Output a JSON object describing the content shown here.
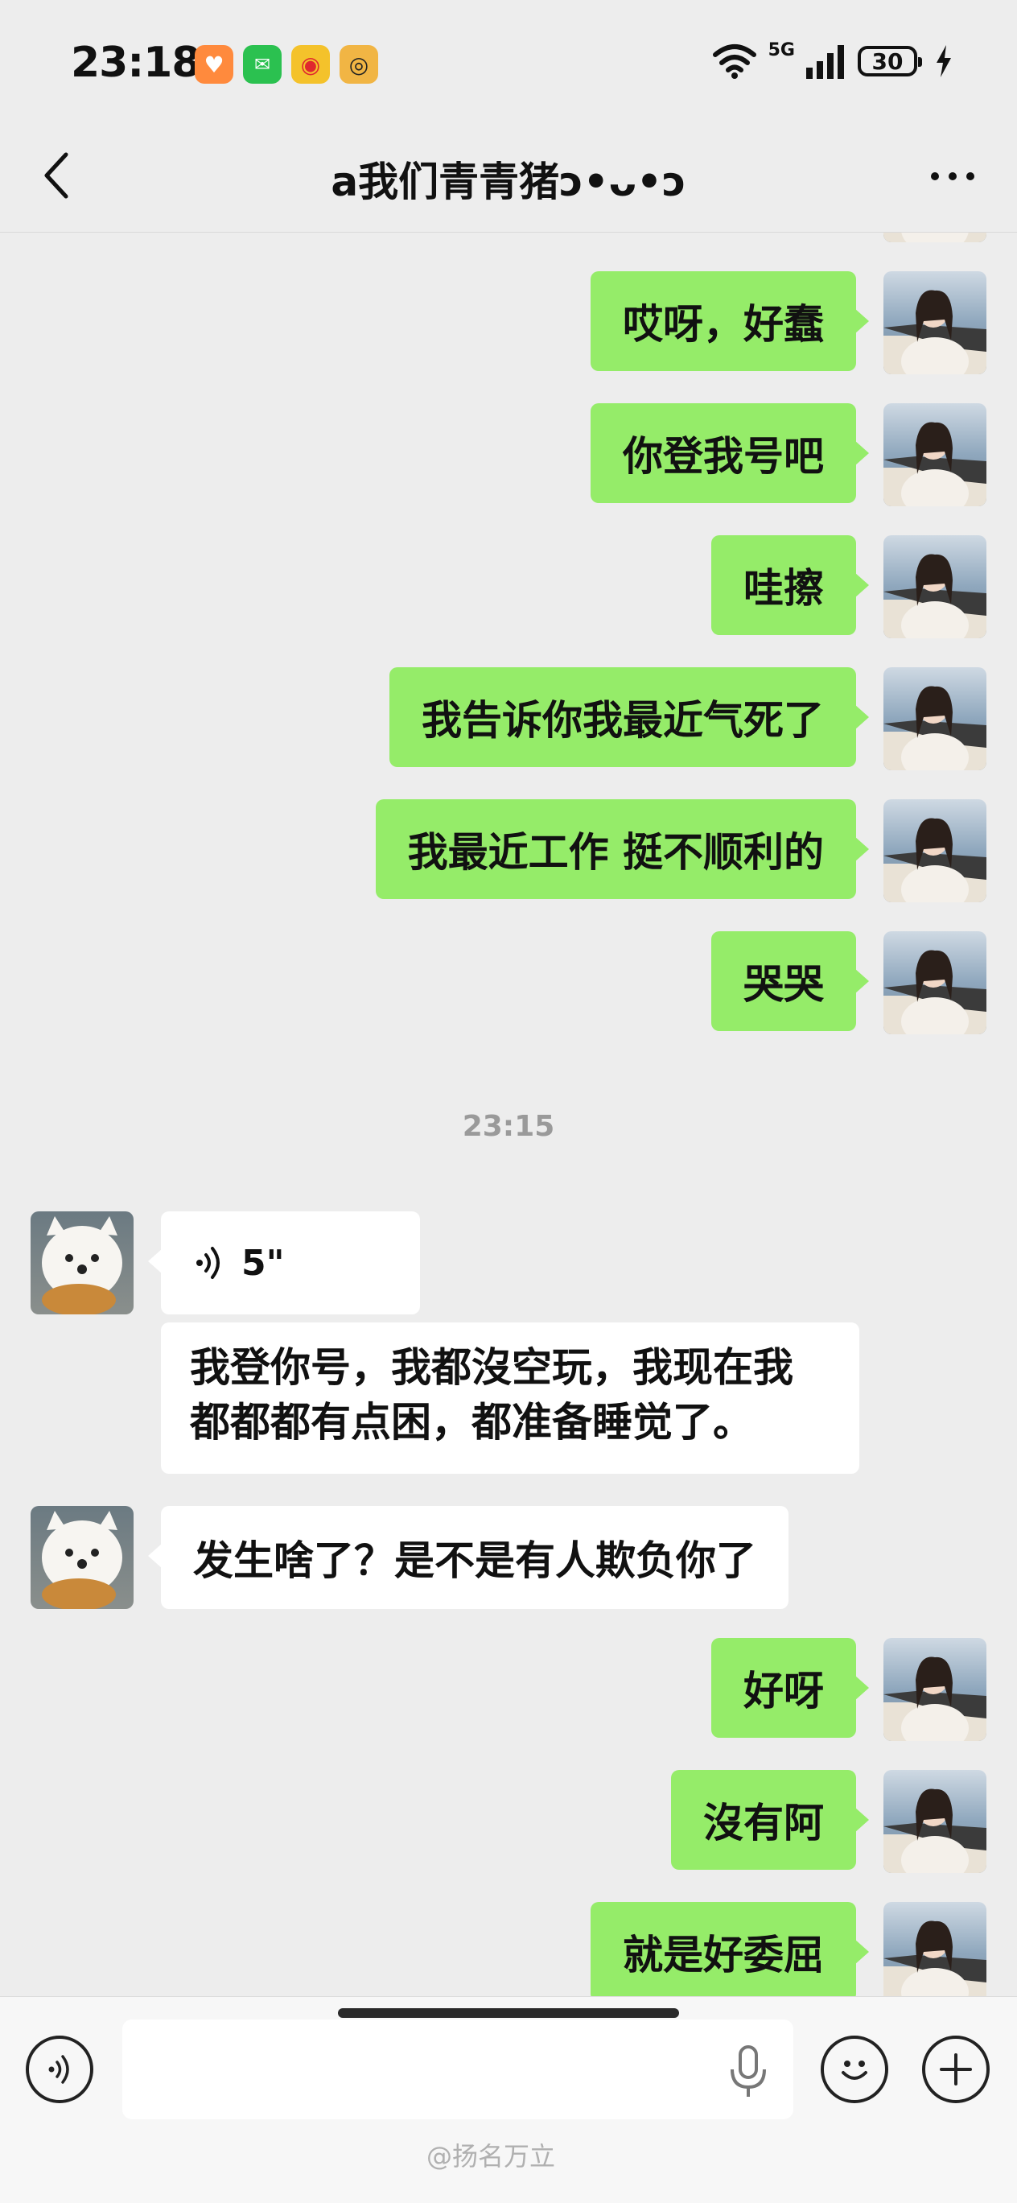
{
  "status_bar": {
    "time": "23:18",
    "network": "5G",
    "battery": "30"
  },
  "header": {
    "title": "a我们青青猪ↄ•ᴗ•ↄ",
    "back_icon": "chevron-left-icon",
    "more_icon": "more-dots-icon"
  },
  "messages_top": [
    {
      "text": "哎呀，好蠢"
    },
    {
      "text": "你登我号吧"
    },
    {
      "text": "哇擦"
    },
    {
      "text": "我告诉你我最近气死了"
    },
    {
      "text": "我最近工作 挺不顺利的"
    },
    {
      "text": "哭哭"
    }
  ],
  "timestamp": "23:15",
  "voice_message": {
    "duration": "5\""
  },
  "friend_messages": [
    {
      "text": "我登你号，我都沒空玩，我现在我都都都有点困，都准备睡觉了。"
    },
    {
      "text": "发生啥了？是不是有人欺负你了"
    }
  ],
  "messages_bottom": [
    {
      "text": "好呀"
    },
    {
      "text": "沒有阿"
    },
    {
      "text": "就是好委屈"
    }
  ],
  "input": {
    "value": "",
    "placeholder": ""
  },
  "watermark": "@扬名万立",
  "colors": {
    "my_bubble": "#95ec69",
    "their_bubble": "#ffffff",
    "background": "#ededed"
  }
}
